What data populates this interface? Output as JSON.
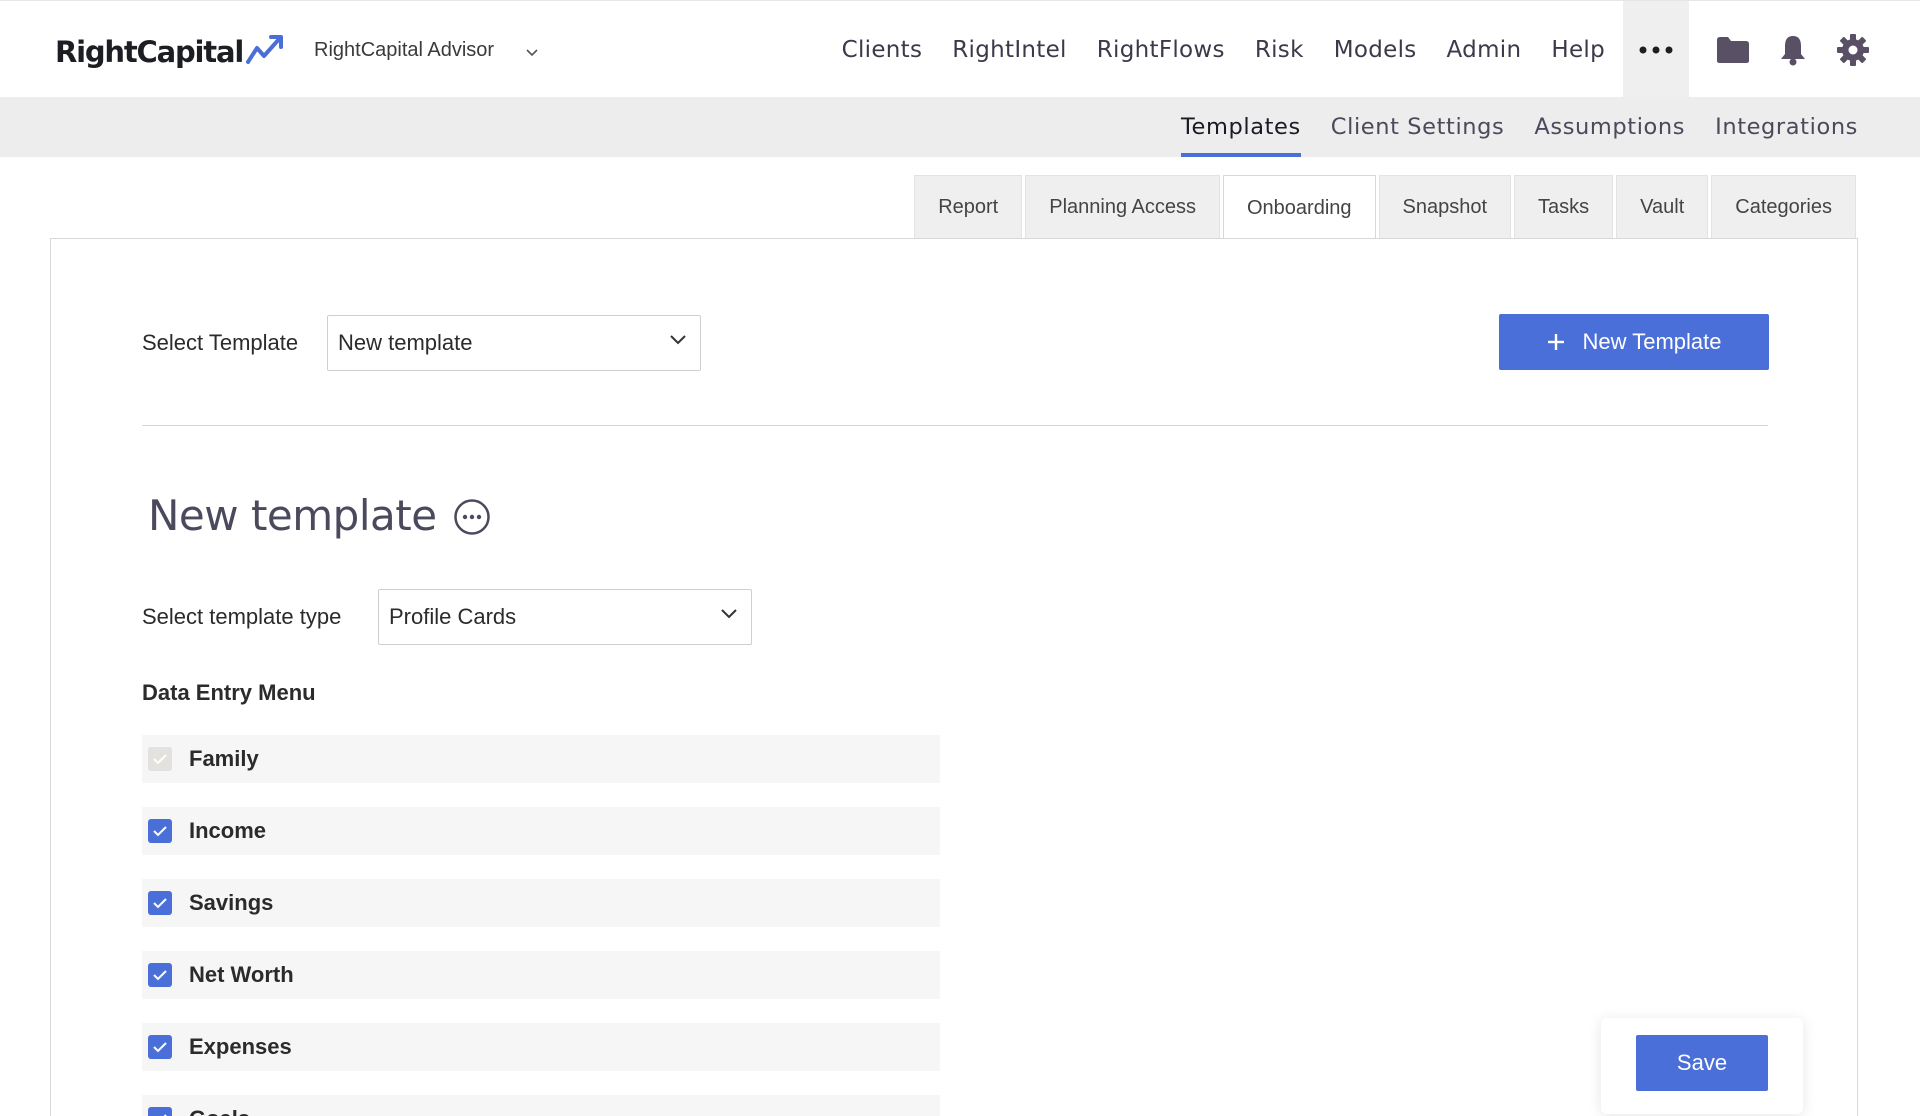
{
  "header": {
    "logo_text": "RightCapital",
    "advisor_name": "RightCapital Advisor",
    "nav": [
      "Clients",
      "RightIntel",
      "RightFlows",
      "Risk",
      "Models",
      "Admin",
      "Help"
    ],
    "icons": [
      "more-horizontal-icon",
      "folder-icon",
      "bell-icon",
      "gear-icon"
    ]
  },
  "subnav": {
    "items": [
      "Templates",
      "Client Settings",
      "Assumptions",
      "Integrations"
    ],
    "active": "Templates"
  },
  "tabs": {
    "items": [
      "Report",
      "Planning Access",
      "Onboarding",
      "Snapshot",
      "Tasks",
      "Vault",
      "Categories"
    ],
    "active": "Onboarding"
  },
  "template_selector": {
    "label": "Select Template",
    "value": "New template",
    "new_button": "New Template"
  },
  "template": {
    "title": "New template",
    "type_label": "Select template type",
    "type_value": "Profile Cards",
    "section_label": "Data Entry Menu",
    "menu_items": [
      {
        "label": "Family",
        "checked": true,
        "disabled": true
      },
      {
        "label": "Income",
        "checked": true,
        "disabled": false
      },
      {
        "label": "Savings",
        "checked": true,
        "disabled": false
      },
      {
        "label": "Net Worth",
        "checked": true,
        "disabled": false
      },
      {
        "label": "Expenses",
        "checked": true,
        "disabled": false
      },
      {
        "label": "Goals",
        "checked": true,
        "disabled": false
      }
    ]
  },
  "save_button": "Save",
  "colors": {
    "accent": "#4a6fd8",
    "subnav_bg": "#ededed",
    "text_dark": "#2b2b2b"
  }
}
